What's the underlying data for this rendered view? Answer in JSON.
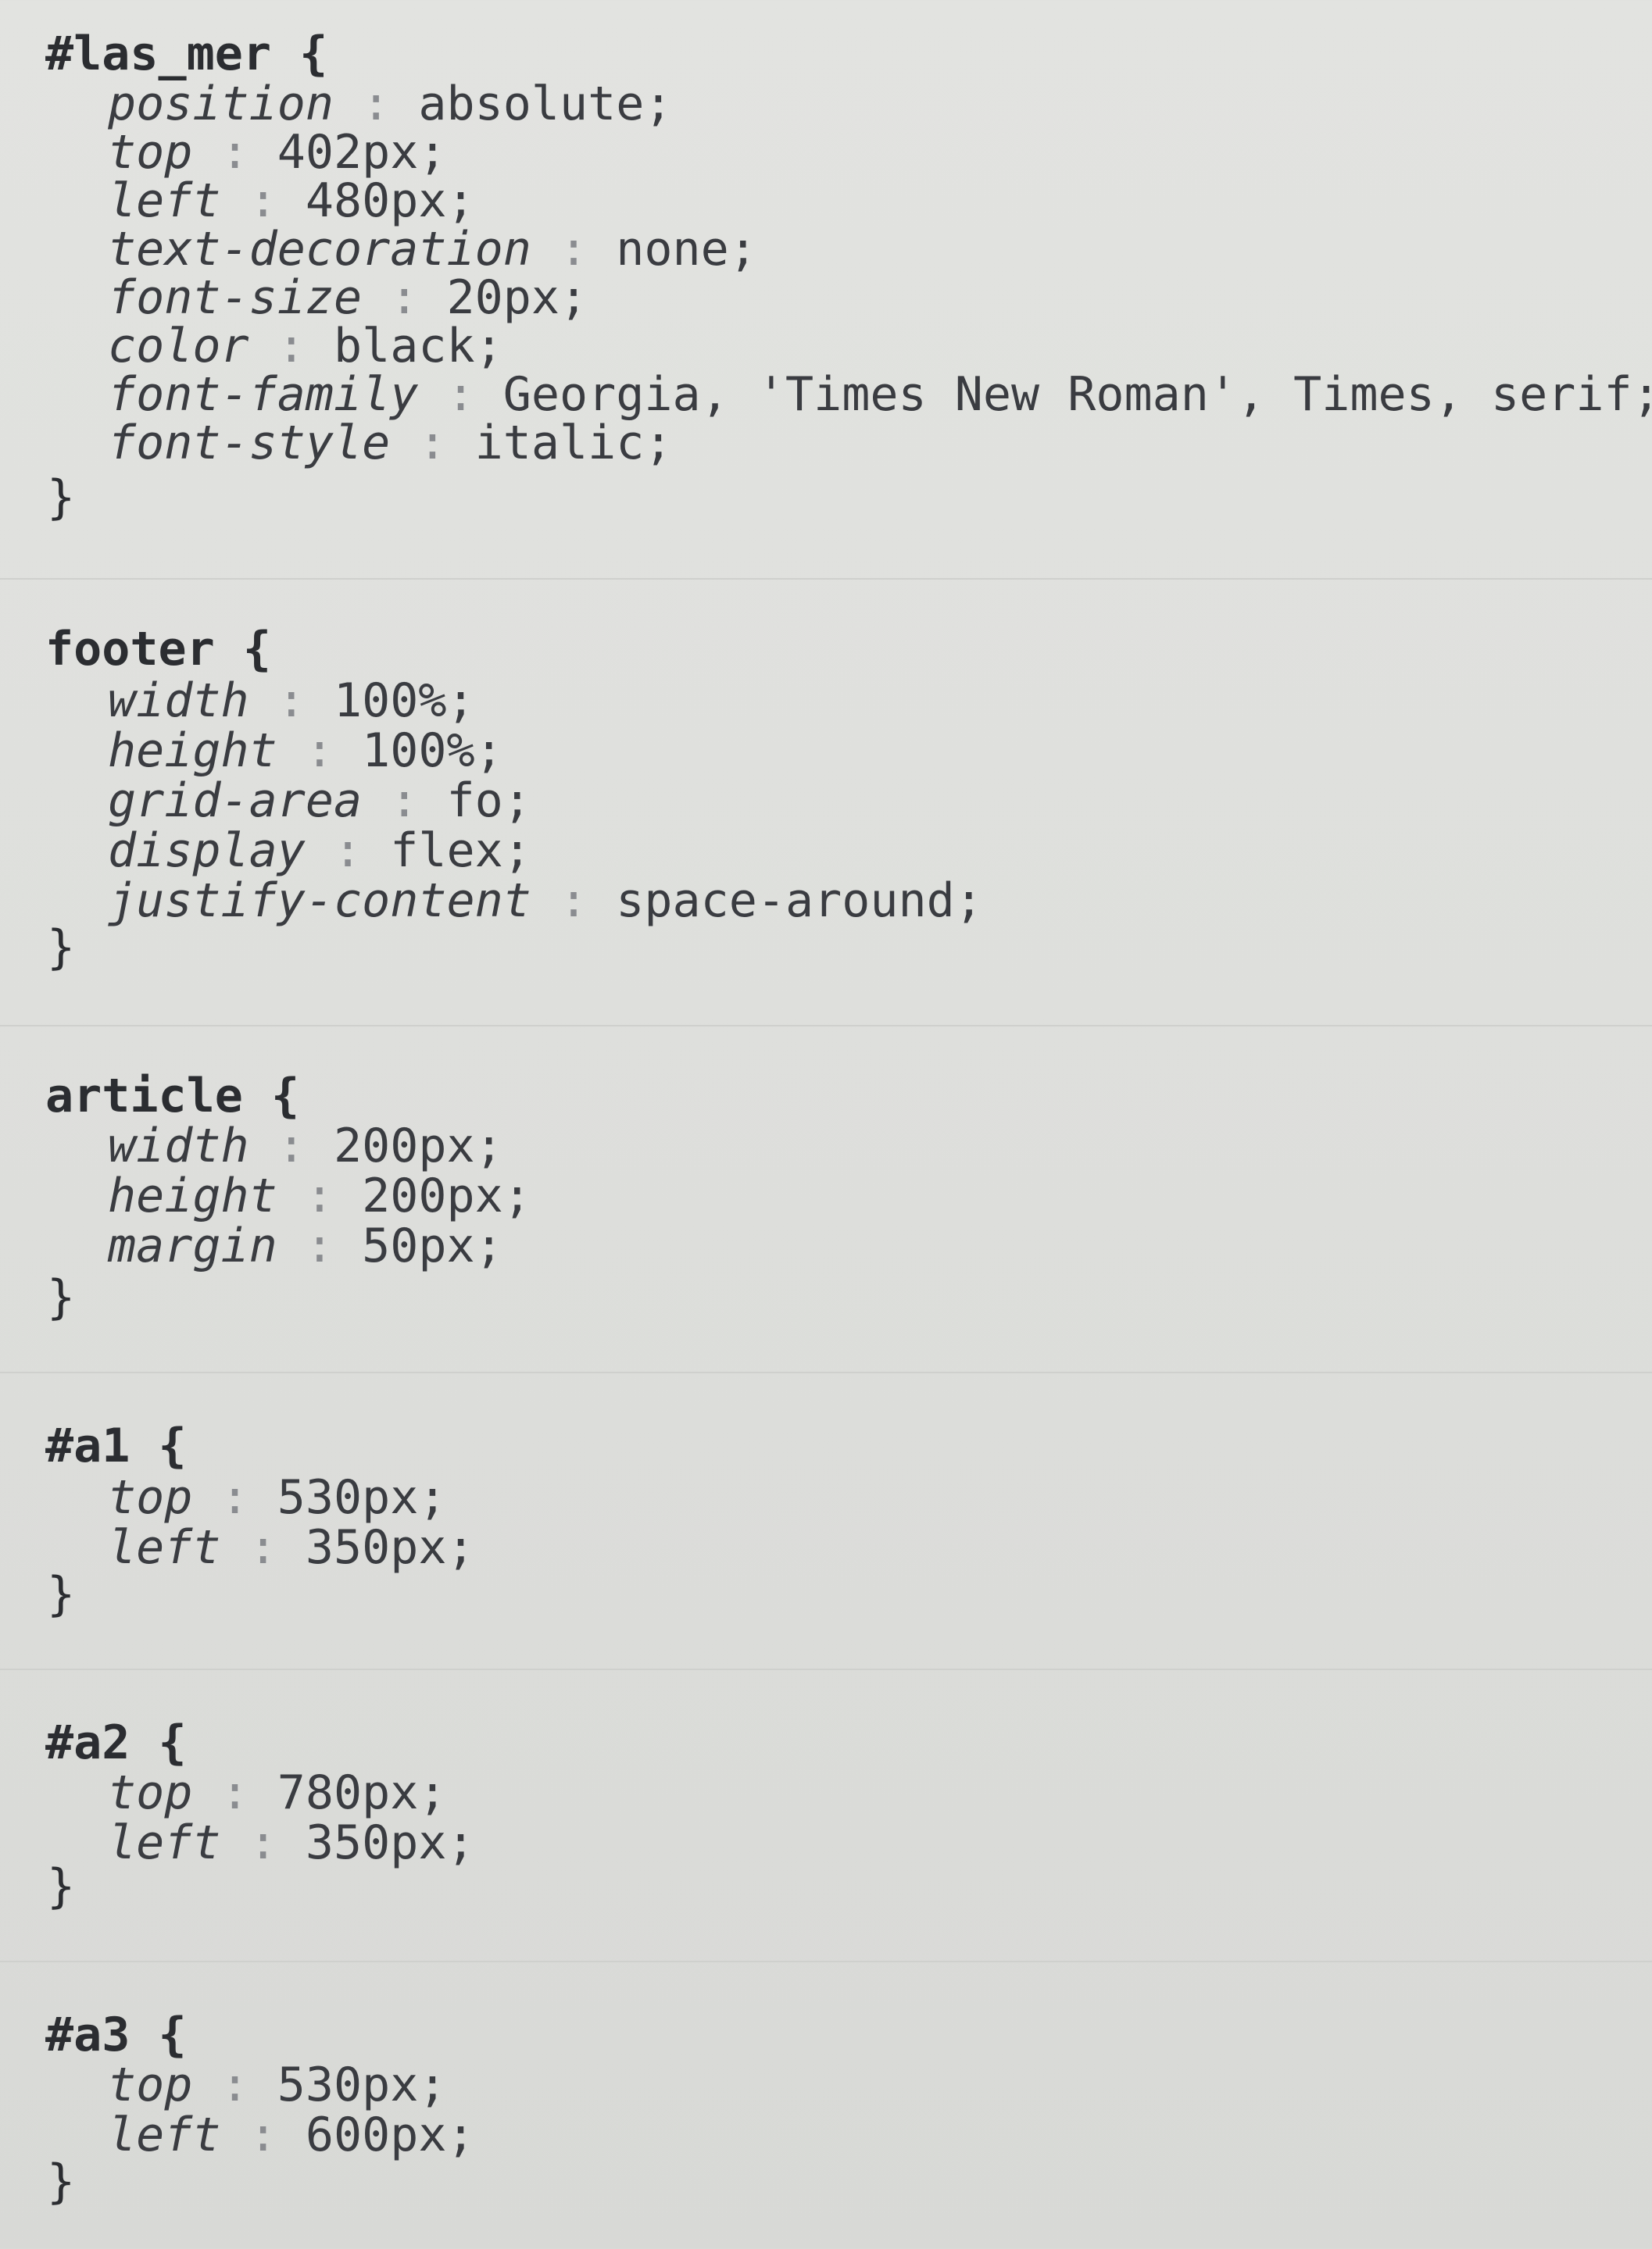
{
  "blocks": [
    {
      "selector": "#las_mer {",
      "decls": [
        {
          "prop": "position",
          "val": "absolute;"
        },
        {
          "prop": "top",
          "val": "402px;"
        },
        {
          "prop": "left",
          "val": "480px;"
        },
        {
          "prop": "text-decoration",
          "val": "none;"
        },
        {
          "prop": "font-size",
          "val": "20px;"
        },
        {
          "prop": "color",
          "val": "black;"
        },
        {
          "prop": "font-family",
          "val": "Georgia, 'Times New Roman', Times, serif;"
        },
        {
          "prop": "font-style",
          "val": "italic;"
        }
      ],
      "close": "}"
    },
    {
      "selector": "footer {",
      "decls": [
        {
          "prop": "width",
          "val": "100%;"
        },
        {
          "prop": "height",
          "val": "100%;"
        },
        {
          "prop": "grid-area",
          "val": "fo;"
        },
        {
          "prop": "display",
          "val": "flex;"
        },
        {
          "prop": "justify-content",
          "val": "space-around;"
        }
      ],
      "close": "}"
    },
    {
      "selector": "article {",
      "decls": [
        {
          "prop": "width",
          "val": "200px;"
        },
        {
          "prop": "height",
          "val": "200px;"
        },
        {
          "prop": "margin",
          "val": "50px;"
        }
      ],
      "close": "}"
    },
    {
      "selector": "#a1 {",
      "decls": [
        {
          "prop": "top",
          "val": "530px;"
        },
        {
          "prop": "left",
          "val": "350px;"
        }
      ],
      "close": "}"
    },
    {
      "selector": "#a2 {",
      "decls": [
        {
          "prop": "top",
          "val": "780px;"
        },
        {
          "prop": "left",
          "val": "350px;"
        }
      ],
      "close": "}"
    },
    {
      "selector": "#a3 {",
      "decls": [
        {
          "prop": "top",
          "val": "530px;"
        },
        {
          "prop": "left",
          "val": "600px;"
        }
      ],
      "close": "}"
    }
  ],
  "separator": " : "
}
